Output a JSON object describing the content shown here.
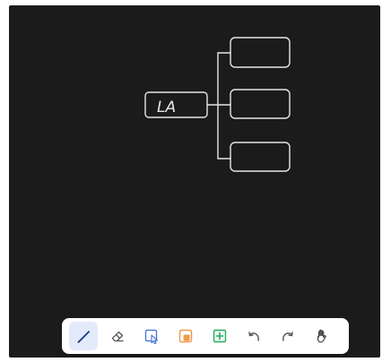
{
  "canvas": {
    "background": "#1b1b1b",
    "stroke_color": "#e6e6e6"
  },
  "mindmap": {
    "root": {
      "label": "LA"
    },
    "children": [
      {
        "label": ""
      },
      {
        "label": ""
      },
      {
        "label": ""
      }
    ]
  },
  "toolbar": {
    "tools": [
      {
        "name": "pen",
        "icon": "pen-icon",
        "active": true
      },
      {
        "name": "eraser",
        "icon": "eraser-icon",
        "active": false
      },
      {
        "name": "select",
        "icon": "select-icon",
        "active": false
      },
      {
        "name": "sticky-note",
        "icon": "sticky-note-icon",
        "active": false,
        "color": "#f2994a"
      },
      {
        "name": "add-shape",
        "icon": "plus-box-icon",
        "active": false,
        "color": "#27ae60"
      },
      {
        "name": "undo",
        "icon": "undo-icon",
        "active": false
      },
      {
        "name": "redo",
        "icon": "redo-icon",
        "active": false
      },
      {
        "name": "pan",
        "icon": "hand-icon",
        "active": false
      }
    ],
    "active_color": "#1d3f8f"
  }
}
